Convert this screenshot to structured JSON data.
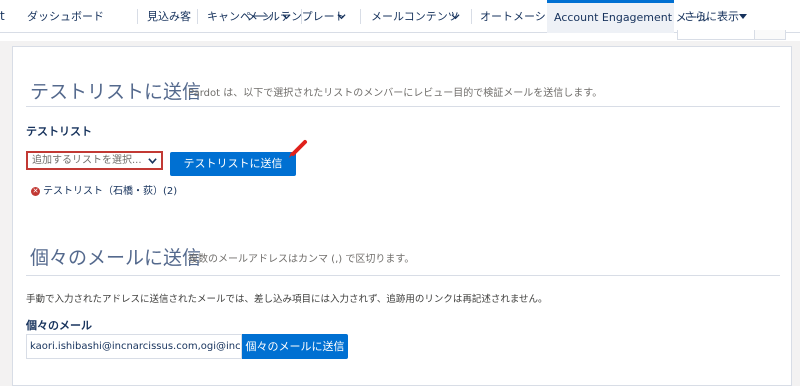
{
  "nav": {
    "app_fragment": "t",
    "items": [
      {
        "label": "ダッシュボード"
      },
      {
        "label": "見込み客"
      },
      {
        "label": "キャンペーン"
      },
      {
        "label": "メールテンプレート"
      },
      {
        "label": "メールコンテンツ"
      },
      {
        "label": "オートメーション"
      },
      {
        "label": "Account Engagement メール"
      },
      {
        "label": "さらに表示"
      }
    ]
  },
  "test_list_section": {
    "title": "テストリストに送信",
    "description": "Pardot は、以下で選択されたリストのメンバーにレビュー目的で検証メールを送信します。",
    "field_label": "テストリスト",
    "select_placeholder": "追加するリストを選択...",
    "send_button": "テストリストに送信",
    "selected_list": "テストリスト（石橋・荻）(2)"
  },
  "individual_section": {
    "title": "個々のメールに送信",
    "description": "複数のメールアドレスはカンマ (,) で区切ります。",
    "note": "手動で入力されたアドレスに送信されたメールでは、差し込み項目には入力されず、追跡用のリンクは再記述されません。",
    "field_label": "個々のメール",
    "email_value": "kaori.ishibashi@incnarcissus.com,ogi@incnarc",
    "send_button": "個々のメールに送信"
  },
  "colors": {
    "brand_blue": "#0070d2",
    "error_red": "#c23934",
    "pen_red": "#e0201b"
  },
  "icons": [
    "chevron-down-icon",
    "remove-icon",
    "red-pen-annotation-icon",
    "caret-down-icon"
  ]
}
